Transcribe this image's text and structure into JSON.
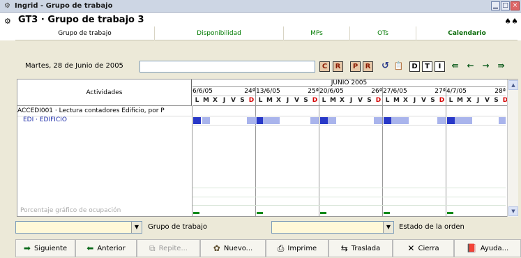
{
  "window": {
    "title": "Ingrid - Grupo de trabajo",
    "title_icon": "group-icon",
    "buttons": [
      {
        "name": "minimize",
        "label": "▁"
      },
      {
        "name": "maximize",
        "label": "□"
      },
      {
        "name": "close",
        "label": "×"
      }
    ]
  },
  "header": {
    "title": "GT3 · Grupo de trabajo 3",
    "icon": "binoculars-icon"
  },
  "tabs": [
    {
      "label": "Grupo de trabajo"
    },
    {
      "label": "Disponibilidad"
    },
    {
      "label": "MPs"
    },
    {
      "label": "OTs"
    },
    {
      "label": "Calendario"
    }
  ],
  "toolbar": {
    "date_label": "Martes, 28 de Junio de 2005",
    "search_value": "",
    "buttons": [
      {
        "label": "C"
      },
      {
        "label": "R"
      },
      {
        "label": "P"
      },
      {
        "label": "R"
      },
      {
        "label": "↺"
      },
      {
        "label": "📋"
      },
      {
        "label": "D"
      },
      {
        "label": "T"
      },
      {
        "label": "I"
      },
      {
        "label": "⇚"
      },
      {
        "label": "←"
      },
      {
        "label": "→"
      },
      {
        "label": "⇛"
      }
    ]
  },
  "calendar": {
    "activities_header": "Actividades",
    "month": "JUNIO 2005",
    "weeks": [
      {
        "date": "6/6/05",
        "num": "24ª"
      },
      {
        "date": "13/6/05",
        "num": "25ª"
      },
      {
        "date": "20/6/05",
        "num": "26ª"
      },
      {
        "date": "27/6/05",
        "num": "27ª"
      },
      {
        "date": "4/7/05",
        "num": "28ª"
      }
    ],
    "days": [
      "L",
      "M",
      "X",
      "J",
      "V",
      "S",
      "D"
    ],
    "rows": [
      {
        "label": "ACCEDI001 · Lectura contadores Edificio, por P"
      },
      {
        "label": "EDI · EDIFICIO"
      }
    ],
    "occupancy_label": "Porcentaje gráfico de ocupación"
  },
  "filters": {
    "group_label": "Grupo de trabajo",
    "group_value": "",
    "status_label": "Estado de la orden",
    "status_value": ""
  },
  "buttons": [
    {
      "label": "Siguiente",
      "icon": "arrow-right-icon"
    },
    {
      "label": "Anterior",
      "icon": "arrow-left-icon"
    },
    {
      "label": "Repite...",
      "icon": "repeat-icon"
    },
    {
      "label": "Nuevo...",
      "icon": "new-icon"
    },
    {
      "label": "Imprime",
      "icon": "print-icon"
    },
    {
      "label": "Traslada",
      "icon": "move-icon"
    },
    {
      "label": "Cierra",
      "icon": "close-icon"
    },
    {
      "label": "Ayuda...",
      "icon": "help-icon"
    }
  ]
}
